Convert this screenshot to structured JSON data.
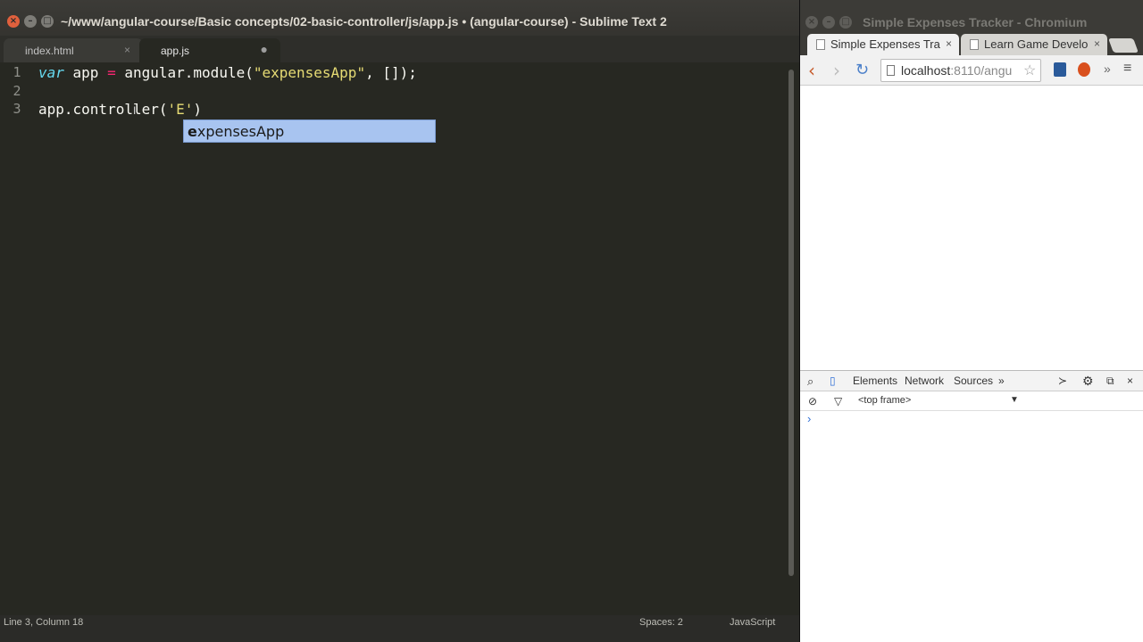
{
  "sublime": {
    "title": "~/www/angular-course/Basic concepts/02-basic-controller/js/app.js • (angular-course) - Sublime Text 2",
    "tabs": [
      {
        "label": "index.html",
        "close": "×"
      },
      {
        "label": "app.js",
        "close": "●"
      }
    ],
    "line_numbers": [
      "1",
      "2",
      "3"
    ],
    "code": {
      "line1": {
        "kw": "var",
        "a": " app ",
        "op": "=",
        "b": " angular.module(",
        "str": "\"expensesApp\"",
        "c": ", []);"
      },
      "line3": {
        "a": "app.controller(",
        "str": "'E'",
        "c": ")"
      }
    },
    "autocomplete": {
      "match": "e",
      "rest": "xpensesApp"
    },
    "status": {
      "position": "Line 3, Column 18",
      "indent": "Spaces: 2",
      "syntax": "JavaScript"
    }
  },
  "chromium": {
    "title": "Simple Expenses Tracker - Chromium",
    "tabs": [
      {
        "label": "Simple Expenses Tra",
        "close": "×"
      },
      {
        "label": "Learn Game Develo",
        "close": "×"
      }
    ],
    "address": {
      "host": "localhost",
      "rest": ":8110/angu"
    },
    "more_label": "»",
    "devtools": {
      "tabs": [
        "Elements",
        "Network",
        "Sources"
      ],
      "more": "»",
      "frame": "<top frame>",
      "prompt": "›"
    }
  }
}
